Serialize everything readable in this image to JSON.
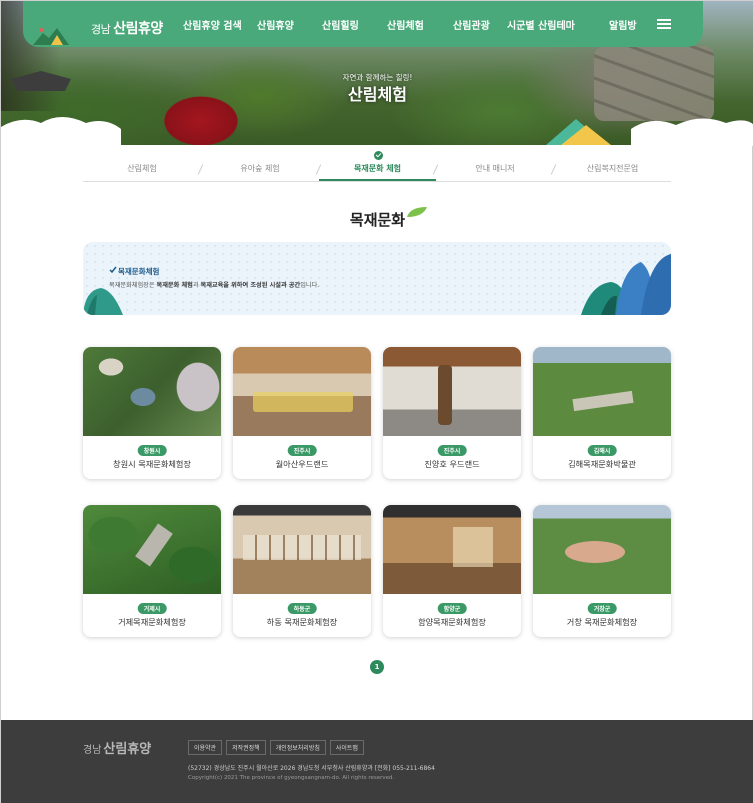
{
  "header": {
    "logo_prefix": "경남",
    "logo_name": "산림휴양",
    "nav": [
      "산림휴양 검색",
      "산림휴양",
      "산림힐링",
      "산림체험",
      "산림관광",
      "시군별 산림테마",
      "알림방"
    ]
  },
  "hero": {
    "subtitle": "자연과 함께하는 힐링!",
    "title": "산림체험"
  },
  "subtabs": [
    {
      "label": "산림체험",
      "active": false
    },
    {
      "label": "유아숲 체험",
      "active": false
    },
    {
      "label": "목재문화 체험",
      "active": true
    },
    {
      "label": "안내 매니저",
      "active": false
    },
    {
      "label": "산림복지전문업",
      "active": false
    }
  ],
  "section_title": "목재문화",
  "info": {
    "heading": "목재문화체험",
    "text_prefix": "목재문화체험장은 ",
    "text_bold_1": "목재문화 체험",
    "text_mid": "과 ",
    "text_bold_2": "목재교육을 위하여 조성된 시설과 공간",
    "text_suffix": "입니다."
  },
  "cards": [
    {
      "region": "창원시",
      "name": "창원시 목재문화체험장"
    },
    {
      "region": "진주시",
      "name": "월아산우드랜드"
    },
    {
      "region": "진주시",
      "name": "진양호 우드랜드"
    },
    {
      "region": "김해시",
      "name": "김해목재문화박물관"
    },
    {
      "region": "거제시",
      "name": "거제목재문화체험장"
    },
    {
      "region": "하동군",
      "name": "하동 목재문화체험장"
    },
    {
      "region": "함양군",
      "name": "함양목재문화체험장"
    },
    {
      "region": "거창군",
      "name": "거창 목재문화체험장"
    }
  ],
  "pagination": {
    "current": "1"
  },
  "footer": {
    "logo_prefix": "경남",
    "logo_name": "산림휴양",
    "links": [
      "이용약관",
      "저작권정책",
      "개인정보처리방침",
      "사이트맵"
    ],
    "address": "(52732) 경상남도 진주시 월아산로 2026 경남도청 서부청사 산림휴양과 [전화] 055-211-6864",
    "copyright": "Copyright(c) 2021 The province of gyeongsangnam-do. All rights reserved."
  },
  "colors": {
    "primary": "#4aa97a",
    "accent": "#2e8a5c",
    "footer_bg": "#3d3d3d"
  }
}
